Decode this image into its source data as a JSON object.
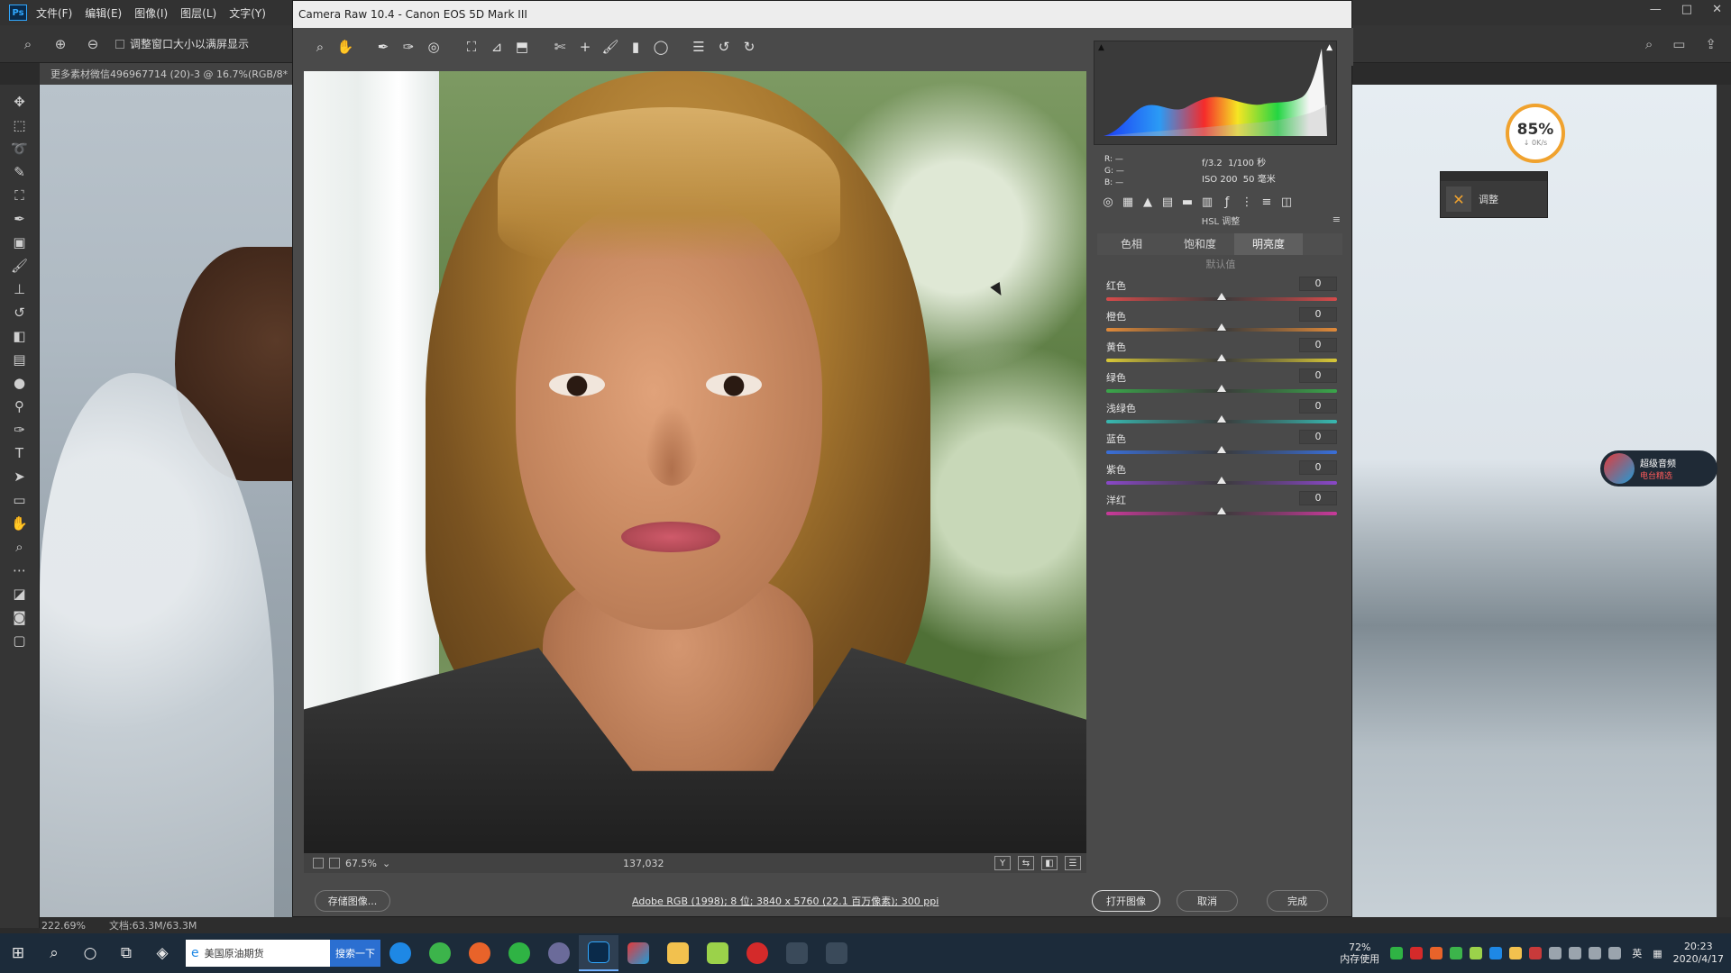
{
  "photoshop": {
    "logo": "Ps",
    "menus": [
      "文件(F)",
      "编辑(E)",
      "图像(I)",
      "图层(L)",
      "文字(Y)"
    ],
    "window_controls": [
      "—",
      "□",
      "✕"
    ],
    "option_checkbox": "调整窗口大小以满屏显示",
    "doc_tab": "更多素材微信496967714 (20)-3 @ 16.7%(RGB/8*",
    "status_zoom": "222.69%",
    "status_doc": "文档:63.3M/63.3M"
  },
  "camera_raw": {
    "title": "Camera Raw 10.4 -  Canon EOS 5D Mark III",
    "histogram": {
      "clip_left": "▲",
      "clip_right": "▲",
      "rgb_labels": [
        "R:",
        "G:",
        "B:"
      ],
      "rgb_values": [
        "—",
        "—",
        "—"
      ],
      "aperture": "f/3.2",
      "shutter": "1/100 秒",
      "iso": "ISO 200",
      "focal": "50 毫米"
    },
    "panel_title": "HSL 调整",
    "tabs": [
      {
        "label": "色相",
        "active": false
      },
      {
        "label": "饱和度",
        "active": false
      },
      {
        "label": "明亮度",
        "active": true
      }
    ],
    "defaults_label": "默认值",
    "sliders": [
      {
        "label": "红色",
        "value": "0",
        "track": [
          "#d64b4b",
          "#3a3a3a",
          "#d64b4b"
        ]
      },
      {
        "label": "橙色",
        "value": "0",
        "track": [
          "#e08a3a",
          "#3a3a3a",
          "#e08a3a"
        ]
      },
      {
        "label": "黄色",
        "value": "0",
        "track": [
          "#d8c838",
          "#3a3a3a",
          "#d8c838"
        ]
      },
      {
        "label": "绿色",
        "value": "0",
        "track": [
          "#3aa64a",
          "#3a3a3a",
          "#3aa64a"
        ]
      },
      {
        "label": "浅绿色",
        "value": "0",
        "track": [
          "#38b8b0",
          "#3a3a3a",
          "#38b8b0"
        ]
      },
      {
        "label": "蓝色",
        "value": "0",
        "track": [
          "#3a6fd8",
          "#3a3a3a",
          "#3a6fd8"
        ]
      },
      {
        "label": "紫色",
        "value": "0",
        "track": [
          "#8a48c8",
          "#3a3a3a",
          "#8a48c8"
        ]
      },
      {
        "label": "洋红",
        "value": "0",
        "track": [
          "#c83a9a",
          "#3a3a3a",
          "#c83a9a"
        ]
      }
    ],
    "preview_zoom": "67.5%",
    "coordinates": "137,032",
    "workflow_link": "Adobe RGB (1998); 8 位; 3840 x 5760 (22.1 百万像素); 300 ppi",
    "buttons": {
      "save": "存储图像...",
      "open": "打开图像",
      "cancel": "取消",
      "done": "完成"
    }
  },
  "overlay": {
    "speed_percent": "85%",
    "speed_rate": "↓ 0K/s",
    "mini_panel_label": "调整",
    "ad_line1": "超级音频",
    "ad_line2": "电台精选"
  },
  "taskbar": {
    "search_text": "美国原油期货",
    "search_button": "搜索一下",
    "memory_percent": "72%",
    "memory_label": "内存使用",
    "ime": "英",
    "time": "20:23",
    "date": "2020/4/17"
  }
}
